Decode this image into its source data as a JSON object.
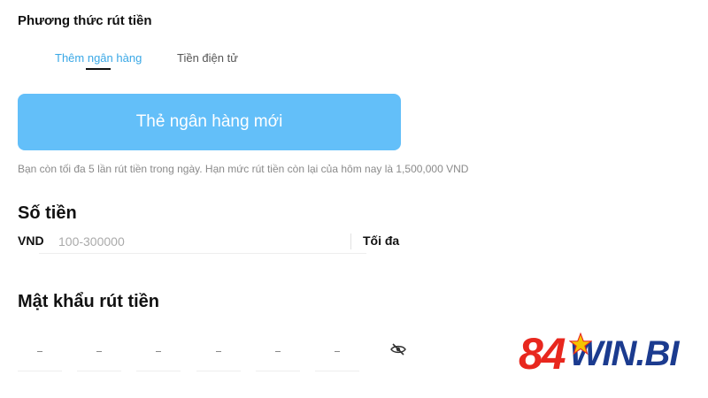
{
  "withdraw": {
    "section_title": "Phương thức rút tiền",
    "tabs": [
      {
        "label": "Thêm ngân hàng",
        "active": true
      },
      {
        "label": "Tiền điện tử",
        "active": false
      }
    ],
    "new_bank_button": "Thẻ ngân hàng mới",
    "limit_note": "Bạn còn tối đa 5 lần rút tiền trong ngày. Hạn mức rút tiền còn lại của hôm nay là 1,500,000 VND"
  },
  "amount": {
    "title": "Số tiền",
    "currency": "VND",
    "placeholder": "100-300000",
    "value": "",
    "max_label": "Tối đa"
  },
  "password": {
    "title": "Mật khẩu rút tiền",
    "digit_count": 6,
    "toggle_icon": "eye-off-icon"
  },
  "branding": {
    "logo_number": "84",
    "logo_text": "WIN.BI"
  },
  "colors": {
    "accent": "#3aa8e6",
    "button": "#63bff9",
    "logo_red": "#e8271e",
    "logo_blue": "#1b3b8f"
  }
}
